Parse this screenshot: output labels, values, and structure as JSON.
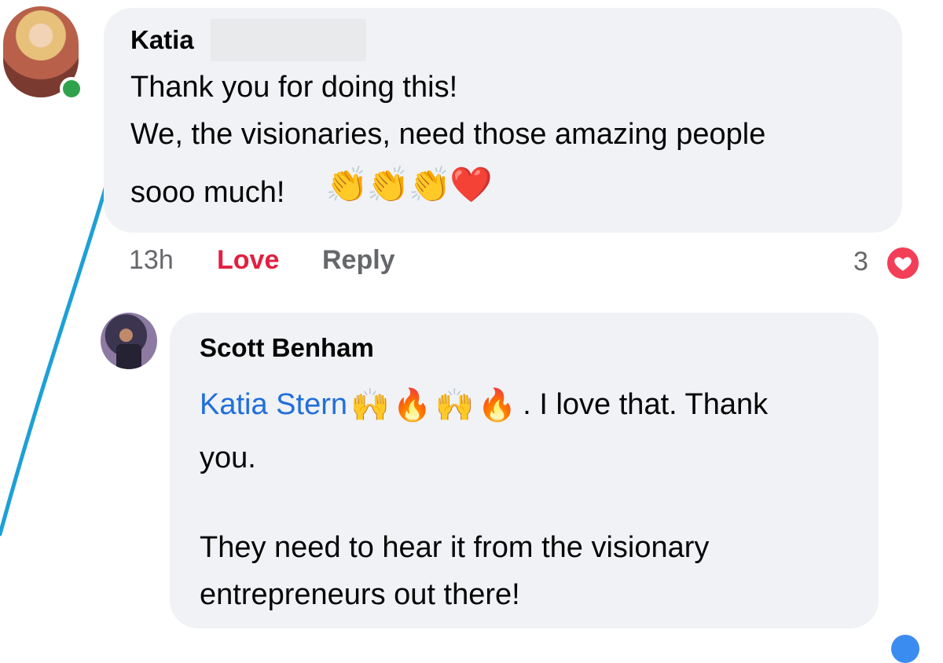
{
  "comments": [
    {
      "author": "Katia",
      "lines": [
        "Thank you for doing this!",
        "We, the visionaries, need those amazing people",
        "sooo much!"
      ],
      "emojis": [
        "👏",
        "👏",
        "👏",
        "❤️"
      ],
      "online": true,
      "time": "13h",
      "love_label": "Love",
      "reply_label": "Reply",
      "reaction_count": "3",
      "reaction_icon": "heart-icon"
    },
    {
      "author": "Scott Benham",
      "mention": "Katia Stern",
      "inline_emojis": [
        "🙌",
        "🔥",
        "🙌",
        "🔥"
      ],
      "line1_rest": ". I love that. Thank",
      "line2": "you.",
      "line3": "They need to hear it from the visionary",
      "line4": "entrepreneurs out there!"
    }
  ],
  "colors": {
    "bubble": "#f0f2f5",
    "love": "#e41e3f",
    "mention": "#216fdb",
    "annotation": "#1ea0d6",
    "online": "#31a24c"
  }
}
